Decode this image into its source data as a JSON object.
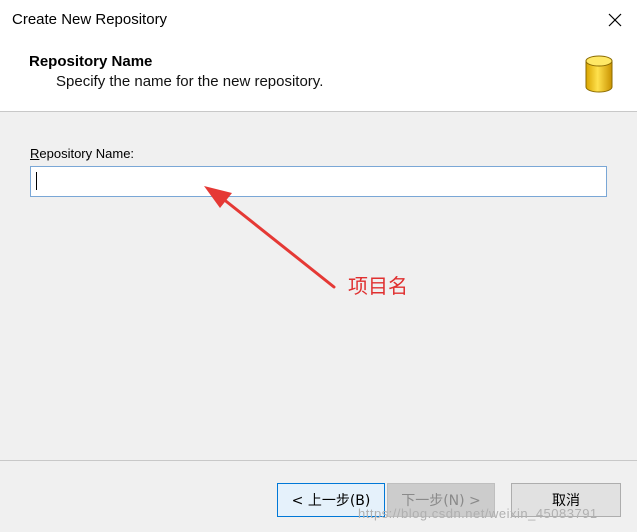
{
  "window": {
    "title": "Create New Repository",
    "close_icon": "close-icon"
  },
  "header": {
    "title": "Repository Name",
    "subtitle": "Specify the name for the new repository.",
    "icon": "database-icon",
    "icon_color": "#f2c200"
  },
  "form": {
    "label_accel": "R",
    "label_rest": "epository Name:",
    "repository_name_value": "",
    "input_border_color": "#7aa7d6"
  },
  "annotation": {
    "text": "项目名",
    "color": "#e03030"
  },
  "buttons": {
    "back": "< 上一步(B)",
    "next": "下一步(N) >",
    "cancel": "取消"
  },
  "watermark": "https://blog.csdn.net/weixin_45083791"
}
